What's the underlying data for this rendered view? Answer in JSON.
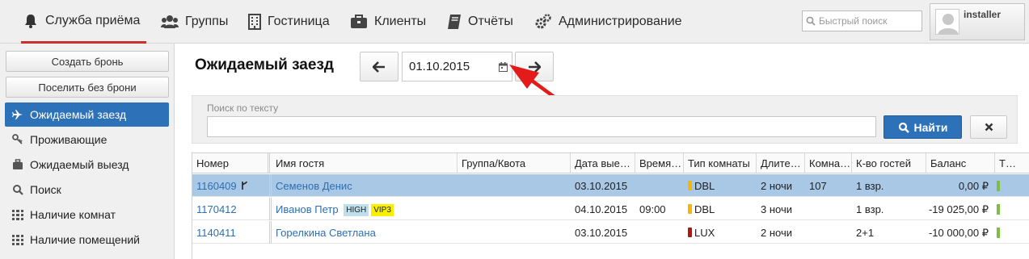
{
  "nav": {
    "items": [
      {
        "label": "Служба приёма",
        "active": true
      },
      {
        "label": "Группы"
      },
      {
        "label": "Гостиница"
      },
      {
        "label": "Клиенты"
      },
      {
        "label": "Отчёты"
      },
      {
        "label": "Администрирование"
      }
    ],
    "search_placeholder": "Быстрый поиск",
    "username": "installer"
  },
  "sidebar": {
    "buttons": [
      {
        "label": "Создать бронь"
      },
      {
        "label": "Поселить без брони"
      }
    ],
    "items": [
      {
        "label": "Ожидаемый заезд",
        "icon": "plane-icon",
        "active": true
      },
      {
        "label": "Проживающие",
        "icon": "key-icon"
      },
      {
        "label": "Ожидаемый выезд",
        "icon": "suitcase-icon"
      },
      {
        "label": "Поиск",
        "icon": "search-icon"
      },
      {
        "label": "Наличие комнат",
        "icon": "grid-icon"
      },
      {
        "label": "Наличие помещений",
        "icon": "grid-icon"
      }
    ]
  },
  "main": {
    "title": "Ожидаемый заезд",
    "date": "01.10.2015",
    "filter": {
      "label": "Поиск по тексту",
      "value": "",
      "find_label": "Найти"
    }
  },
  "table": {
    "headers": [
      "Номер",
      "Имя гостя",
      "Группа/Квота",
      "Дата вые…",
      "Время…",
      "Тип комнаты",
      "Длите…",
      "Комна…",
      "К-во гостей",
      "Баланс",
      "Т…"
    ],
    "rows": [
      {
        "number": "1160409",
        "guest": "Семенов Денис",
        "badges": [],
        "group": "",
        "date": "03.10.2015",
        "time": "",
        "room_type": "DBL",
        "room_type_color": "#f2b705",
        "duration": "2 ночи",
        "room": "107",
        "guests": "1 взр.",
        "balance": "0,00 ₽",
        "selected": true,
        "split_icon": true
      },
      {
        "number": "1170412",
        "guest": "Иванов Петр",
        "badges": [
          {
            "text": "HIGH",
            "color": "#bfe0ea"
          },
          {
            "text": "VIP3",
            "color": "#f8f000"
          }
        ],
        "group": "",
        "date": "04.10.2015",
        "time": "09:00",
        "room_type": "DBL",
        "room_type_color": "#f2b705",
        "duration": "3 ночи",
        "room": "",
        "guests": "1 взр.",
        "balance": "-19 025,00 ₽",
        "selected": false
      },
      {
        "number": "1140411",
        "guest": "Горелкина Светлана",
        "badges": [],
        "group": "",
        "date": "03.10.2015",
        "time": "",
        "room_type": "LUX",
        "room_type_color": "#b01818",
        "duration": "2 ночи",
        "room": "",
        "guests": "2+1",
        "balance": "-10 000,00 ₽",
        "selected": false
      }
    ]
  },
  "colors": {
    "accent": "#2d72b8",
    "active_tab_underline": "#c9302c",
    "selected_row": "#a8c8e6",
    "annotation_arrow": "#e31b1b"
  }
}
